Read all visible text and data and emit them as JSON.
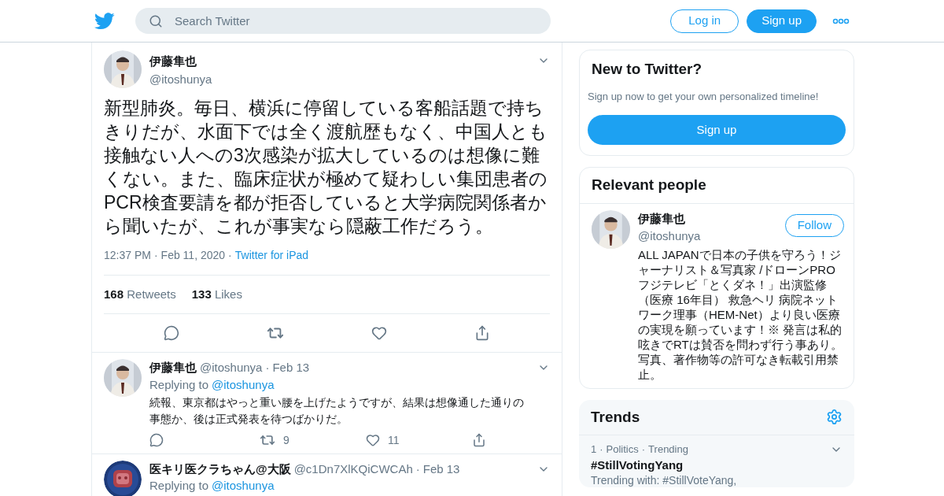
{
  "sep": "·",
  "header": {
    "search": {
      "placeholder": "Search Twitter"
    },
    "buttons": [
      {
        "label": "Log in",
        "kind": "outline"
      },
      {
        "label": "Sign up",
        "kind": "filled"
      }
    ]
  },
  "tweet": {
    "name": "伊藤隼也",
    "handle": "@itoshunya",
    "text": "新型肺炎。毎日、横浜に停留している客船話題で持ちきりだが、水面下では全く渡航歴もなく、中国人とも接触ない人への3次感染が拡大しているのは想像に難くない。また、臨床症状が極めて疑わしい集団患者のPCR検査要請を都が拒否していると大学病院関係者から聞いたが、これが事実なら隠蔽工作だろう。",
    "time": "12:37 PM",
    "date": "Feb 11, 2020",
    "source": "Twitter for iPad",
    "stats": [
      {
        "count": "168",
        "label": "Retweets"
      },
      {
        "count": "133",
        "label": "Likes"
      }
    ]
  },
  "replies": [
    {
      "name": "伊藤隼也",
      "handle": "@itoshunya",
      "date": "Feb 13",
      "replying_label": "Replying to",
      "replying_to": "@itoshunya",
      "text": "続報、東京都はやっと重い腰を上げたようですが、結果は想像通した通りの事態か、後は正式発表を待つばかりだ。",
      "retweets": "9",
      "likes": "11"
    },
    {
      "name": "医キリ医クラちゃん@大阪",
      "handle": "@c1Dn7XlKQiCWCAh",
      "date": "Feb 13",
      "replying_label": "Replying to",
      "replying_to": "@itoshunya"
    }
  ],
  "signup_card": {
    "title": "New to Twitter?",
    "text": "Sign up now to get your own personalized timeline!",
    "button": "Sign up"
  },
  "relevant_people": {
    "title": "Relevant people",
    "person": {
      "name": "伊藤隼也",
      "handle": "@itoshunya",
      "follow": "Follow",
      "bio": "ALL JAPANで日本の子供を守ろう！ジャーナリスト＆写真家 /ドローンPRO フジテレビ「とくダネ！」出演監修（医療 16年目） 救急ヘリ 病院ネットワーク理事（HEM-Net）より良い医療の実現を願っています！※ 発言は私的呟きでRTは賛否を問わず行う事あり。写真、著作物等の許可なき転載引用禁止。"
    }
  },
  "trends": {
    "title": "Trends",
    "items": [
      {
        "rank": "1",
        "category": "Politics",
        "status": "Trending",
        "tag": "#StillVotingYang",
        "context": "Trending with: #StillVoteYang,"
      }
    ]
  }
}
